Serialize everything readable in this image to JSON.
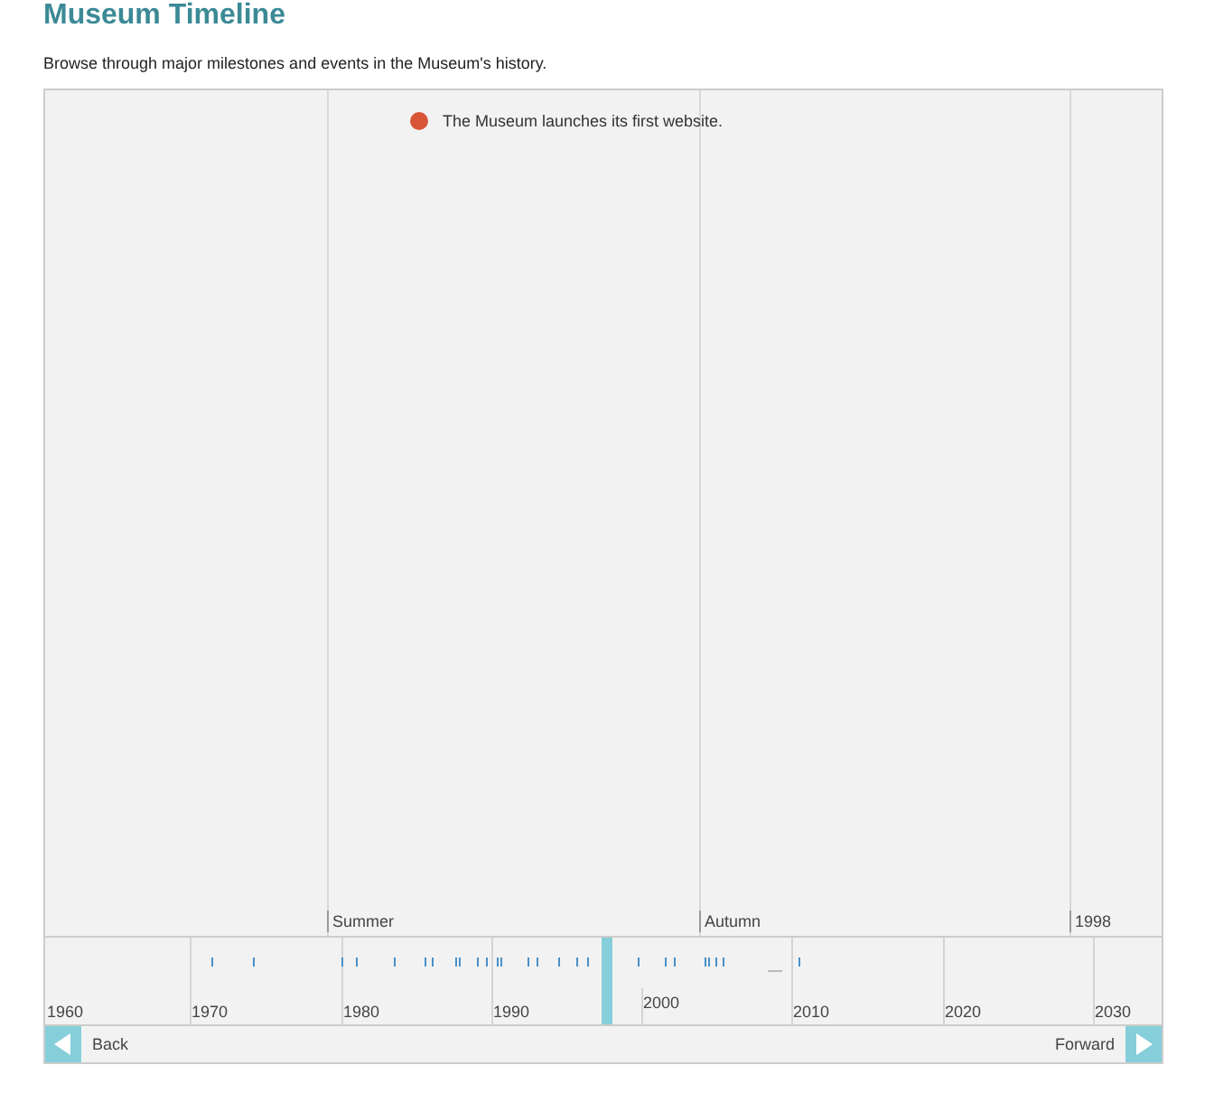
{
  "title": "Museum Timeline",
  "subtitle": "Browse through major milestones and events in the Museum's history.",
  "events": [
    {
      "text": "The Museum launches its first website."
    }
  ],
  "band_labels": [
    "Summer",
    "Autumn",
    "1998"
  ],
  "overview_labels": [
    "1960",
    "1970",
    "1980",
    "1990",
    "2000",
    "2010",
    "2020",
    "2030"
  ],
  "nav": {
    "back": "Back",
    "forward": "Forward"
  }
}
